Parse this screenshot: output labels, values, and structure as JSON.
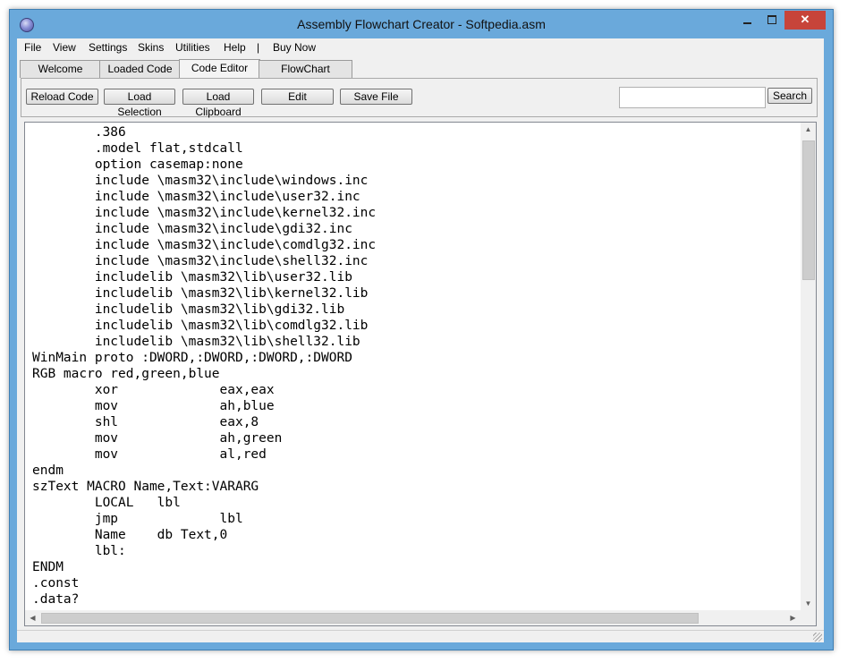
{
  "window": {
    "title": "Assembly Flowchart Creator - Softpedia.asm",
    "accent_color": "#6aa9db",
    "close_color": "#c7443a",
    "minimize_glyph": "",
    "maximize_glyph": "",
    "close_glyph": "✕"
  },
  "menu": {
    "items": [
      "File",
      "View",
      "Settings",
      "Skins",
      "Utilities",
      "Help",
      "|",
      "Buy Now"
    ]
  },
  "tabs": {
    "items": [
      "Welcome",
      "Loaded Code",
      "Code Editor",
      "FlowChart"
    ],
    "active": "Code Editor"
  },
  "toolbar": {
    "buttons": [
      "Reload Code",
      "Load Selection",
      "Load Clipboard",
      "Edit",
      "Save File"
    ],
    "search_value": "",
    "search_label": "Search"
  },
  "editor": {
    "lines": [
      "        .386",
      "        .model flat,stdcall",
      "        option casemap:none",
      "        include \\masm32\\include\\windows.inc",
      "        include \\masm32\\include\\user32.inc",
      "        include \\masm32\\include\\kernel32.inc",
      "        include \\masm32\\include\\gdi32.inc",
      "        include \\masm32\\include\\comdlg32.inc",
      "        include \\masm32\\include\\shell32.inc",
      "        includelib \\masm32\\lib\\user32.lib",
      "        includelib \\masm32\\lib\\kernel32.lib",
      "        includelib \\masm32\\lib\\gdi32.lib",
      "        includelib \\masm32\\lib\\comdlg32.lib",
      "        includelib \\masm32\\lib\\shell32.lib",
      "WinMain proto :DWORD,:DWORD,:DWORD,:DWORD",
      "RGB macro red,green,blue",
      "        xor             eax,eax",
      "        mov             ah,blue",
      "        shl             eax,8",
      "        mov             ah,green",
      "        mov             al,red",
      "endm",
      "szText MACRO Name,Text:VARARG",
      "        LOCAL   lbl",
      "        jmp             lbl",
      "        Name    db Text,0",
      "        lbl:",
      "ENDM",
      ".const",
      ".data?"
    ],
    "scroll_up_glyph": "▲",
    "scroll_down_glyph": "▼",
    "scroll_left_glyph": "◀",
    "scroll_right_glyph": "▶"
  }
}
